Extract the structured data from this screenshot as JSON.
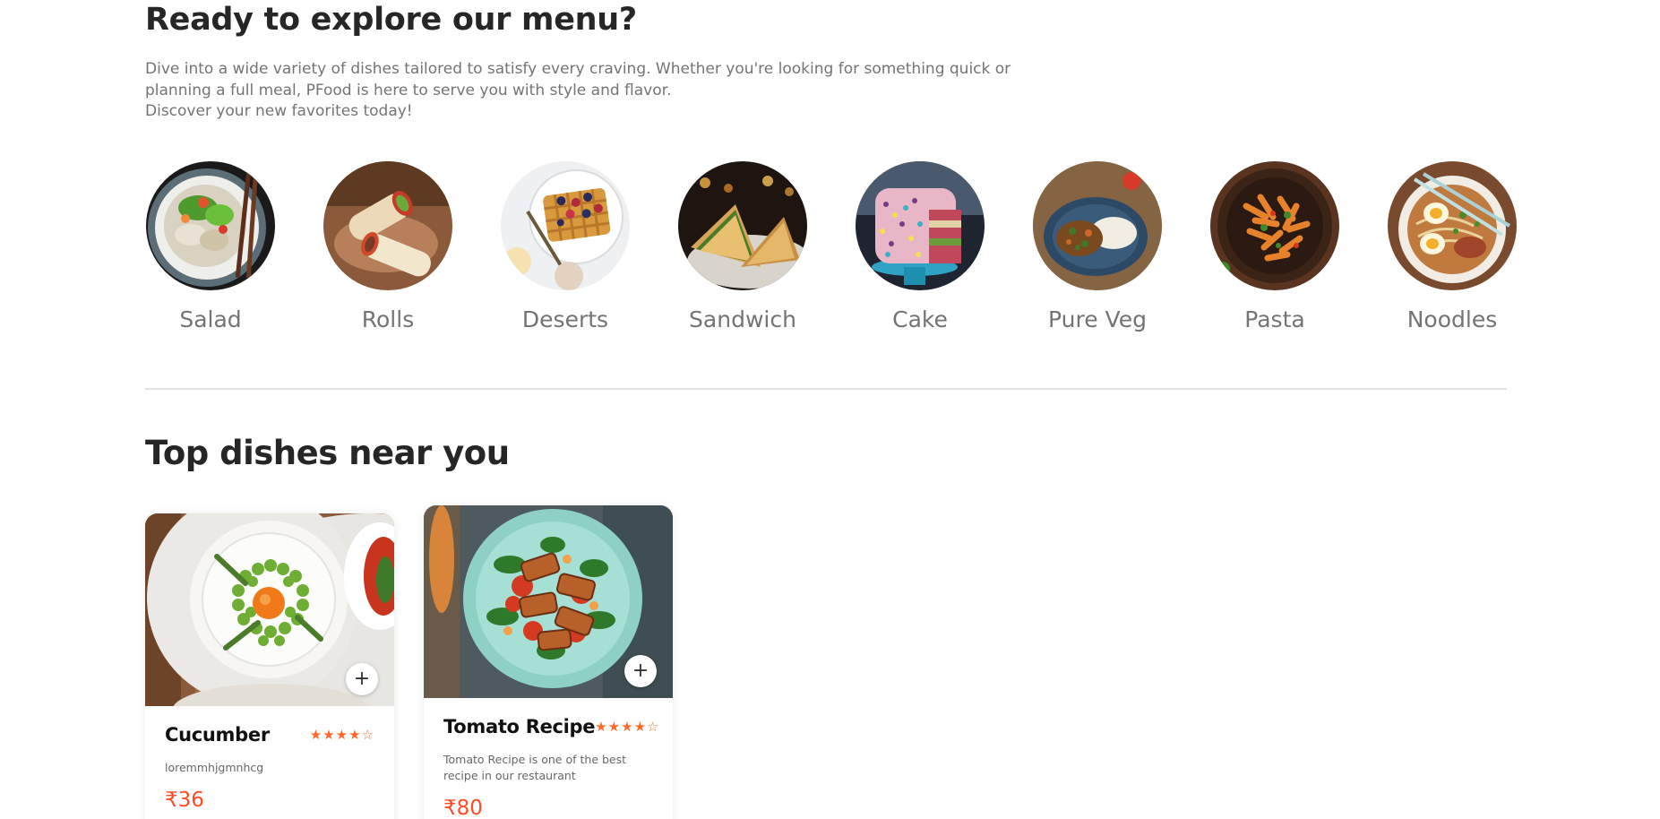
{
  "explore": {
    "title": "Ready to explore our menu?",
    "description_lines": [
      "Dive into a wide variety of dishes tailored to satisfy every craving. Whether you're looking for something quick or",
      "planning a full meal, PFood is here to serve you with style and flavor.",
      "Discover your new favorites today!"
    ]
  },
  "menu": [
    {
      "label": "Salad",
      "icon": "salad-image"
    },
    {
      "label": "Rolls",
      "icon": "rolls-image"
    },
    {
      "label": "Deserts",
      "icon": "deserts-image"
    },
    {
      "label": "Sandwich",
      "icon": "sandwich-image"
    },
    {
      "label": "Cake",
      "icon": "cake-image"
    },
    {
      "label": "Pure Veg",
      "icon": "pure-veg-image"
    },
    {
      "label": "Pasta",
      "icon": "pasta-image"
    },
    {
      "label": "Noodles",
      "icon": "noodles-image"
    }
  ],
  "dishes": {
    "title": "Top dishes near you",
    "items": [
      {
        "name": "Cucumber",
        "rating": 4,
        "stars": "★★★★☆",
        "description": "loremmhjgmnhcg",
        "price": "₹36",
        "add": "+"
      },
      {
        "name": "Tomato Recipe",
        "rating": 4,
        "stars": "★★★★☆",
        "description": "Tomato Recipe is one of the best recipe in our restaurant",
        "price": "₹80",
        "add": "+"
      }
    ]
  },
  "colors": {
    "accent": "#ff4c24",
    "star": "#ff6a2b",
    "text_dark": "#262626",
    "text_muted": "#747474",
    "divider": "#e2e2e2"
  }
}
